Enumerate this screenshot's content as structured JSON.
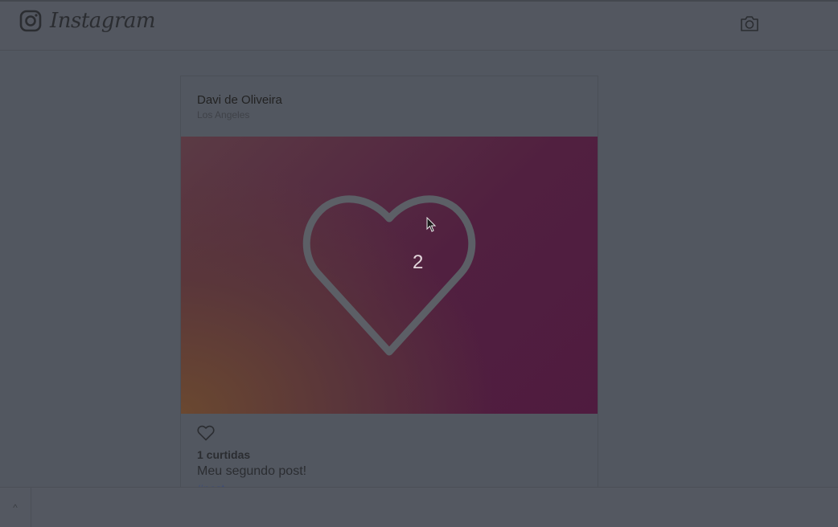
{
  "header": {
    "app_name": "Instagram",
    "logo_icon": "instagram-logo-icon",
    "camera_icon": "camera-icon"
  },
  "post": {
    "author": "Davi de Oliveira",
    "location": "Los Angeles",
    "overlay_like_count": "2",
    "likes_text": "1 curtidas",
    "caption": "Meu segundo post!",
    "hashtag": "#post",
    "like_icon": "heart-outline-icon"
  },
  "footer": {
    "collapse_glyph": "^"
  },
  "colors": {
    "background": "#525760",
    "photo_gradient_start": "#6a4830",
    "photo_gradient_end": "#4f1b3f",
    "heart_stroke": "#5c5f66"
  }
}
